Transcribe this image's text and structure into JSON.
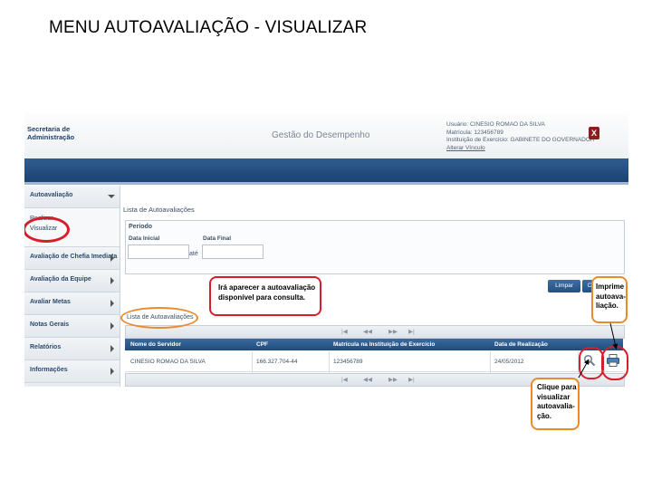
{
  "slide_title": "MENU AUTOAVALIAÇÃO - VISUALIZAR",
  "header": {
    "org_line1": "Secretaria de",
    "org_line2": "Administração",
    "app_title": "Gestão do Desempenho",
    "user_line1": "Usuário: CINESIO ROMAO DA SILVA",
    "user_line2": "Matrícula: 123456789",
    "user_line3": "Instituição de Exercício: GABINETE DO GOVERNADOR",
    "user_line4": "Alterar Vínculo",
    "close_label": "X"
  },
  "sidebar": {
    "items": [
      {
        "label": "Autoavaliação"
      },
      {
        "label": "Avaliação de Chefia Imediata"
      },
      {
        "label": "Avaliação da Equipe"
      },
      {
        "label": "Avaliar Metas"
      },
      {
        "label": "Notas Gerais"
      },
      {
        "label": "Relatórios"
      },
      {
        "label": "Informações"
      }
    ],
    "sub_items": [
      {
        "label": "Realizar"
      },
      {
        "label": "Visualizar"
      }
    ]
  },
  "main": {
    "list_title": "Lista de Autoavaliações",
    "period_legend": "Período",
    "date_start_label": "Data Inicial",
    "date_end_label": "Data Final",
    "date_start_value": "",
    "date_end_value": "",
    "ate_label": "até",
    "limpar_label": "Limpar",
    "consultar_label": "C",
    "grid_title": "Lista de Autoavaliações",
    "pager": {
      "first": "|◀",
      "prev": "◀◀",
      "next": "▶▶",
      "last": "▶|"
    },
    "columns": [
      "Nome do Servidor",
      "CPF",
      "Matrícula na Instituição de Exercício",
      "Data de Realização"
    ],
    "rows": [
      [
        "CINESIO ROMAO DA SILVA",
        "166.327.704-44",
        "123456789",
        "24/05/2012"
      ]
    ]
  },
  "annotations": {
    "consult": [
      "Irá aparecer a autoavaliação",
      "disponível para consulta."
    ],
    "print": [
      "Imprime",
      "autoava-",
      "liação."
    ],
    "view": [
      "Clique para",
      "visualizar",
      "autoavalia-",
      "ção."
    ]
  },
  "colors": {
    "nav_blue": "#1b4373",
    "red_highlight": "#d41f2b",
    "orange_highlight": "#e98b2d"
  }
}
